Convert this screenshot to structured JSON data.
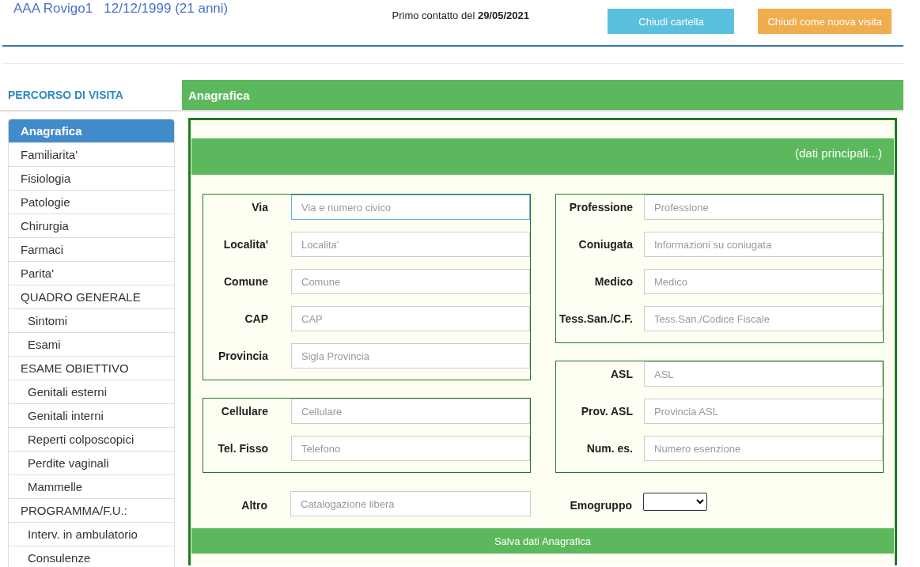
{
  "header": {
    "patient": "AAA Rovigo1",
    "birth": "12/12/1999 (21 anni)",
    "first_contact_label": "Primo contatto del",
    "first_contact_date": "29/05/2021",
    "buttons": [
      {
        "label": "Chiudi cartella",
        "kind": "info"
      },
      {
        "label": "Chiudi come nuova visita",
        "kind": "warning"
      }
    ]
  },
  "sidebar": {
    "title": "PERCORSO DI VISITA",
    "items": [
      {
        "label": "Anagrafica",
        "selected": true
      },
      {
        "label": "Familiarita'",
        "selected": false
      },
      {
        "label": "Fisiologia",
        "selected": false
      },
      {
        "label": "Patologie",
        "selected": false
      },
      {
        "label": "Chirurgia",
        "selected": false
      },
      {
        "label": "Farmaci",
        "selected": false
      },
      {
        "label": "Parita'",
        "selected": false
      },
      {
        "label": "QUADRO GENERALE",
        "selected": false,
        "children": [
          {
            "label": "Sintomi",
            "selected": false
          },
          {
            "label": "Esami",
            "selected": false
          }
        ]
      },
      {
        "label": "ESAME OBIETTIVO",
        "selected": false,
        "children": [
          {
            "label": "Genitali esterni",
            "selected": false
          },
          {
            "label": "Genitali interni",
            "selected": false
          },
          {
            "label": "Reperti colposcopici",
            "selected": false
          },
          {
            "label": "Perdite vaginali",
            "selected": false
          },
          {
            "label": "Mammelle",
            "selected": false
          }
        ]
      },
      {
        "label": "PROGRAMMA/F.U.:",
        "selected": false,
        "children": [
          {
            "label": "Interv. in ambulatorio",
            "selected": false
          },
          {
            "label": "Consulenze",
            "selected": false
          }
        ]
      }
    ]
  },
  "panel": {
    "title": "Anagrafica",
    "band": "(dati principali...)",
    "columns": [
      {
        "groups": [
          {
            "fields": [
              {
                "label": "Via",
                "placeholder": "Via e numero civico",
                "focused": true
              },
              {
                "label": "Localita'",
                "placeholder": "Localita'",
                "focused": false
              },
              {
                "label": "Comune",
                "placeholder": "Comune",
                "focused": false
              },
              {
                "label": "CAP",
                "placeholder": "CAP",
                "focused": false
              },
              {
                "label": "Provincia",
                "placeholder": "Sigla Provincia",
                "focused": false
              }
            ]
          },
          {
            "fields": [
              {
                "label": "Cellulare",
                "placeholder": "Cellulare",
                "focused": false
              },
              {
                "label": "Tel. Fisso",
                "placeholder": "Telefono",
                "focused": false
              }
            ]
          }
        ]
      },
      {
        "groups": [
          {
            "fields": [
              {
                "label": "Professione",
                "placeholder": "Professione",
                "focused": false
              },
              {
                "label": "Coniugata",
                "placeholder": "Informazioni su coniugata",
                "focused": false
              },
              {
                "label": "Medico",
                "placeholder": "Medico",
                "focused": false
              },
              {
                "label": "Tess.San./C.F.",
                "placeholder": "Tess.San./Codice Fiscale",
                "focused": false
              }
            ]
          },
          {
            "fields": [
              {
                "label": "ASL",
                "placeholder": "ASL",
                "focused": false
              },
              {
                "label": "Prov. ASL",
                "placeholder": "Provincia ASL",
                "focused": false
              },
              {
                "label": "Num. es.",
                "placeholder": "Numero esenzione",
                "focused": false
              }
            ]
          }
        ]
      }
    ],
    "bottom": [
      {
        "label": "Altro",
        "kind": "text",
        "placeholder": "Catalogazione libera"
      },
      {
        "label": "Emogruppo",
        "kind": "select"
      }
    ],
    "save_button": "Salva dati Anagrafica"
  }
}
